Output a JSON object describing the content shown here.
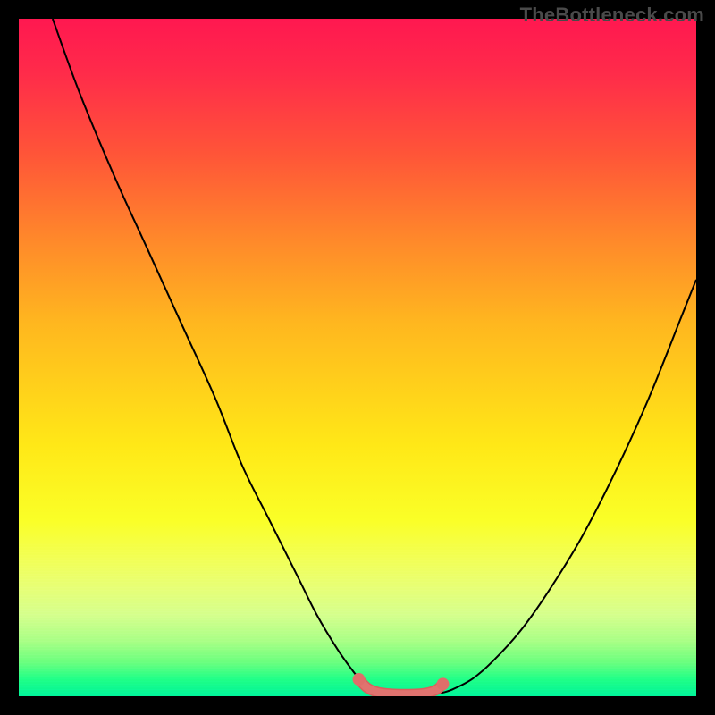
{
  "watermark": "TheBottleneck.com",
  "colors": {
    "curve_stroke": "#000000",
    "trough_fill": "#e0736f",
    "trough_stroke": "#d9605d",
    "trough_dot": "#df6e6a",
    "background_black": "#000000",
    "gradient_top": "#ff1850",
    "gradient_bottom": "#00f59a"
  },
  "chart_data": {
    "type": "line",
    "title": "",
    "xlabel": "",
    "ylabel": "",
    "xlim": [
      0,
      100
    ],
    "ylim": [
      0,
      100
    ],
    "grid": false,
    "legend": false,
    "note": "Axes are unlabeled; x and y are normalized 0-100. Two curve branches descend from left/right edges to a flat trough near y≈0 between roughly x≈50-62. A short salmon rounded segment with endpoint dots sits on the trough.",
    "series": [
      {
        "name": "left-branch",
        "x": [
          5,
          9,
          14,
          19,
          24,
          29,
          33,
          37,
          41,
          44,
          47,
          49.5,
          51.5,
          53
        ],
        "values": [
          100,
          89,
          77,
          66,
          55,
          44,
          34,
          26,
          18,
          12,
          7,
          3.5,
          1.2,
          0.4
        ]
      },
      {
        "name": "right-branch",
        "x": [
          62,
          64,
          67,
          70,
          74,
          78,
          83,
          88,
          93,
          98,
          100
        ],
        "values": [
          0.4,
          1.0,
          2.6,
          5.2,
          9.6,
          15.2,
          23.3,
          33.0,
          44.0,
          56.5,
          61.5
        ]
      },
      {
        "name": "trough-highlight",
        "x": [
          50.2,
          51.5,
          53,
          55,
          57,
          59,
          60.5,
          61.7,
          62.6
        ],
        "values": [
          2.5,
          1.2,
          0.6,
          0.35,
          0.3,
          0.35,
          0.55,
          1.0,
          1.8
        ]
      }
    ],
    "trough_markers": [
      {
        "x": 50.2,
        "y": 2.5
      },
      {
        "x": 62.6,
        "y": 1.8
      }
    ]
  }
}
